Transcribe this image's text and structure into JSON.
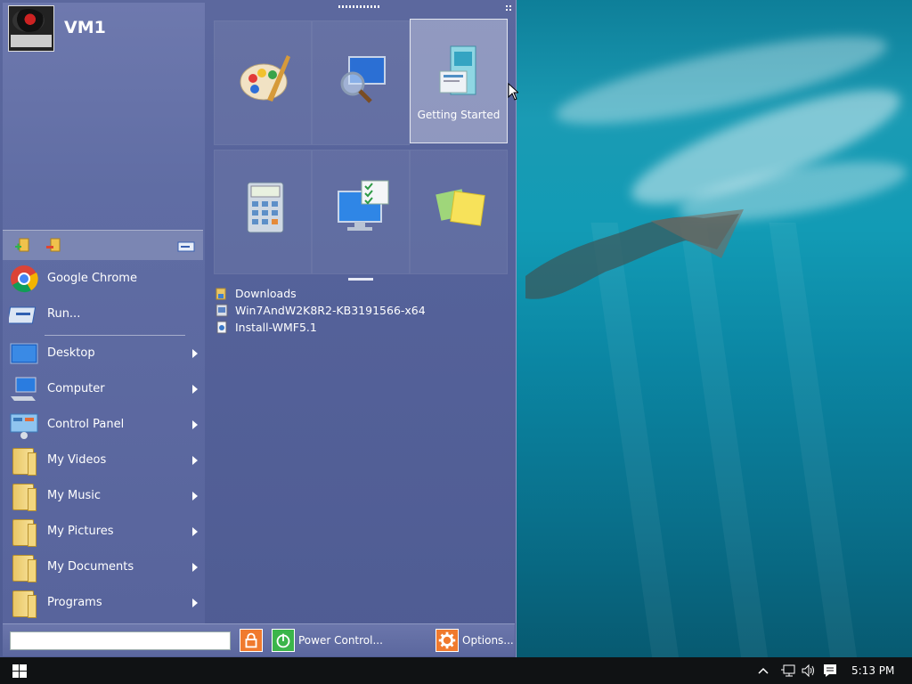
{
  "user": {
    "name": "VM1"
  },
  "left_menu": {
    "pinned": [
      {
        "label": "Google Chrome",
        "icon": "chrome-icon"
      },
      {
        "label": "Run...",
        "icon": "run-icon"
      }
    ],
    "places": [
      {
        "label": "Desktop",
        "icon": "desktop-icon"
      },
      {
        "label": "Computer",
        "icon": "computer-icon"
      },
      {
        "label": "Control Panel",
        "icon": "control-panel-icon"
      },
      {
        "label": "My Videos",
        "icon": "folder-videos-icon"
      },
      {
        "label": "My Music",
        "icon": "folder-music-icon"
      },
      {
        "label": "My Pictures",
        "icon": "folder-pictures-icon"
      },
      {
        "label": "My Documents",
        "icon": "folder-documents-icon"
      },
      {
        "label": "Programs",
        "icon": "folder-programs-icon"
      }
    ]
  },
  "tiles": [
    {
      "label": "",
      "icon": "paint-icon"
    },
    {
      "label": "",
      "icon": "magnifier-icon"
    },
    {
      "label": "Getting Started",
      "icon": "getting-started-icon",
      "selected": true
    },
    {
      "label": "",
      "icon": "calculator-icon"
    },
    {
      "label": "",
      "icon": "action-center-icon"
    },
    {
      "label": "",
      "icon": "sticky-notes-icon"
    }
  ],
  "recent_files": [
    {
      "label": "Downloads",
      "icon": "folder-icon"
    },
    {
      "label": "Win7AndW2K8R2-KB3191566-x64",
      "icon": "installer-icon"
    },
    {
      "label": "Install-WMF5.1",
      "icon": "script-icon"
    }
  ],
  "bottom_bar": {
    "search_placeholder": "",
    "power_label": "Power Control...",
    "options_label": "Options..."
  },
  "taskbar": {
    "time": "5:13 PM"
  },
  "colors": {
    "lock": "#f07a2e",
    "power": "#3bb54a",
    "options": "#f07a2e"
  }
}
